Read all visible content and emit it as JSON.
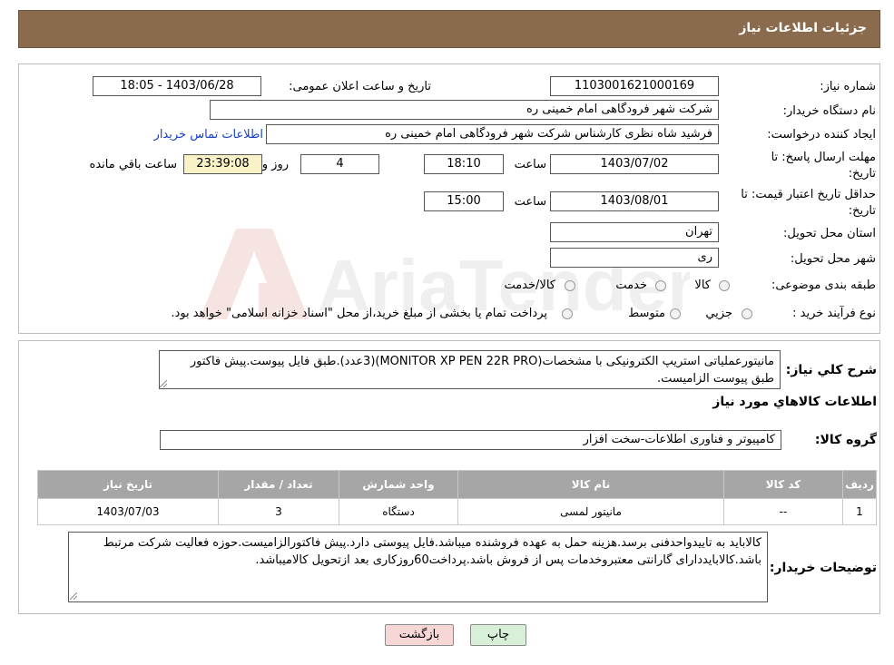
{
  "header": {
    "title": "جزئیات اطلاعات نیاز"
  },
  "form": {
    "need_number_label": "شماره نیاز:",
    "need_number": "1103001621000169",
    "announce_label": "تاریخ و ساعت اعلان عمومی:",
    "announce_value": "1403/06/28 - 18:05",
    "buyer_org_label": "نام دستگاه خریدار:",
    "buyer_org": "شرکت شهر فرودگاهی امام خمینی  ره",
    "creator_label": "ایجاد کننده درخواست:",
    "creator": "فرشید شاه نظری کارشناس شرکت شهر فرودگاهی امام خمینی  ره",
    "buyer_contact_link": "اطلاعات تماس خریدار",
    "deadline_label_1": "مهلت ارسال پاسخ: تا",
    "deadline_label_2": "تاریخ:",
    "deadline_date": "1403/07/02",
    "time_word": "ساعت",
    "deadline_time": "18:10",
    "days_value": "4",
    "day_and": "روز و",
    "remaining_time": "23:39:08",
    "remaining_label": "ساعت باقي مانده",
    "validity_label_1": "حداقل تاریخ اعتبار قیمت: تا",
    "validity_label_2": "تاریخ:",
    "validity_date": "1403/08/01",
    "validity_time": "15:00",
    "province_label": "استان محل تحویل:",
    "province": "تهران",
    "city_label": "شهر محل تحویل:",
    "city": "ری",
    "category_label": "طبقه بندی موضوعی:",
    "category_options": [
      "کالا",
      "خدمت",
      "کالا/خدمت"
    ],
    "process_label": "نوع فرآیند خرید :",
    "process_options": [
      "جزيي",
      "متوسط"
    ],
    "process_note": "پرداخت تمام یا بخشی از مبلغ خرید،از محل \"اسناد خزانه اسلامی\" خواهد بود."
  },
  "description": {
    "label": "شرح کلي نياز:",
    "text": "مانیتورعملیاتی استریپ الکترونیکی با مشخصات(MONITOR XP PEN 22R PRO)(3عدد).طبق فایل پیوست.پیش فاکتور طبق پیوست الزامیست."
  },
  "goods": {
    "section_title": "اطلاعات کالاهاي مورد نياز",
    "group_label": "گروه کالا:",
    "group_value": "کامپیوتر و فناوری اطلاعات-سخت افزار",
    "table": {
      "headers": [
        "رديف",
        "کد کالا",
        "نام کالا",
        "واحد شمارش",
        "تعداد / مقدار",
        "تاریخ نیاز"
      ],
      "rows": [
        [
          "1",
          "--",
          "مانیتور لمسی",
          "دستگاه",
          "3",
          "1403/07/03"
        ]
      ]
    }
  },
  "buyer_notes": {
    "label": "توضیحات خریدار:",
    "text": "کالاباید به تاییدواحدفنی برسد.هزینه حمل به عهده فروشنده میباشد.فایل پیوستی دارد.پیش فاکتورالزامیست.حوزه فعالیت شرکت مرتبط باشد.کالابایددارای گارانتی معتبروخدمات پس از فروش باشد.پرداخت60روزکاری بعد ازتحویل کالامیباشد."
  },
  "buttons": {
    "print": "چاپ",
    "back": "بازگشت"
  },
  "watermark": {
    "text": "AriaTender.neT"
  },
  "colors": {
    "header_bg": "#8a6b4e",
    "link": "#1a3fc6",
    "back_btn_bg": "#f7d6d6",
    "print_btn_bg": "#d8f0d8"
  }
}
